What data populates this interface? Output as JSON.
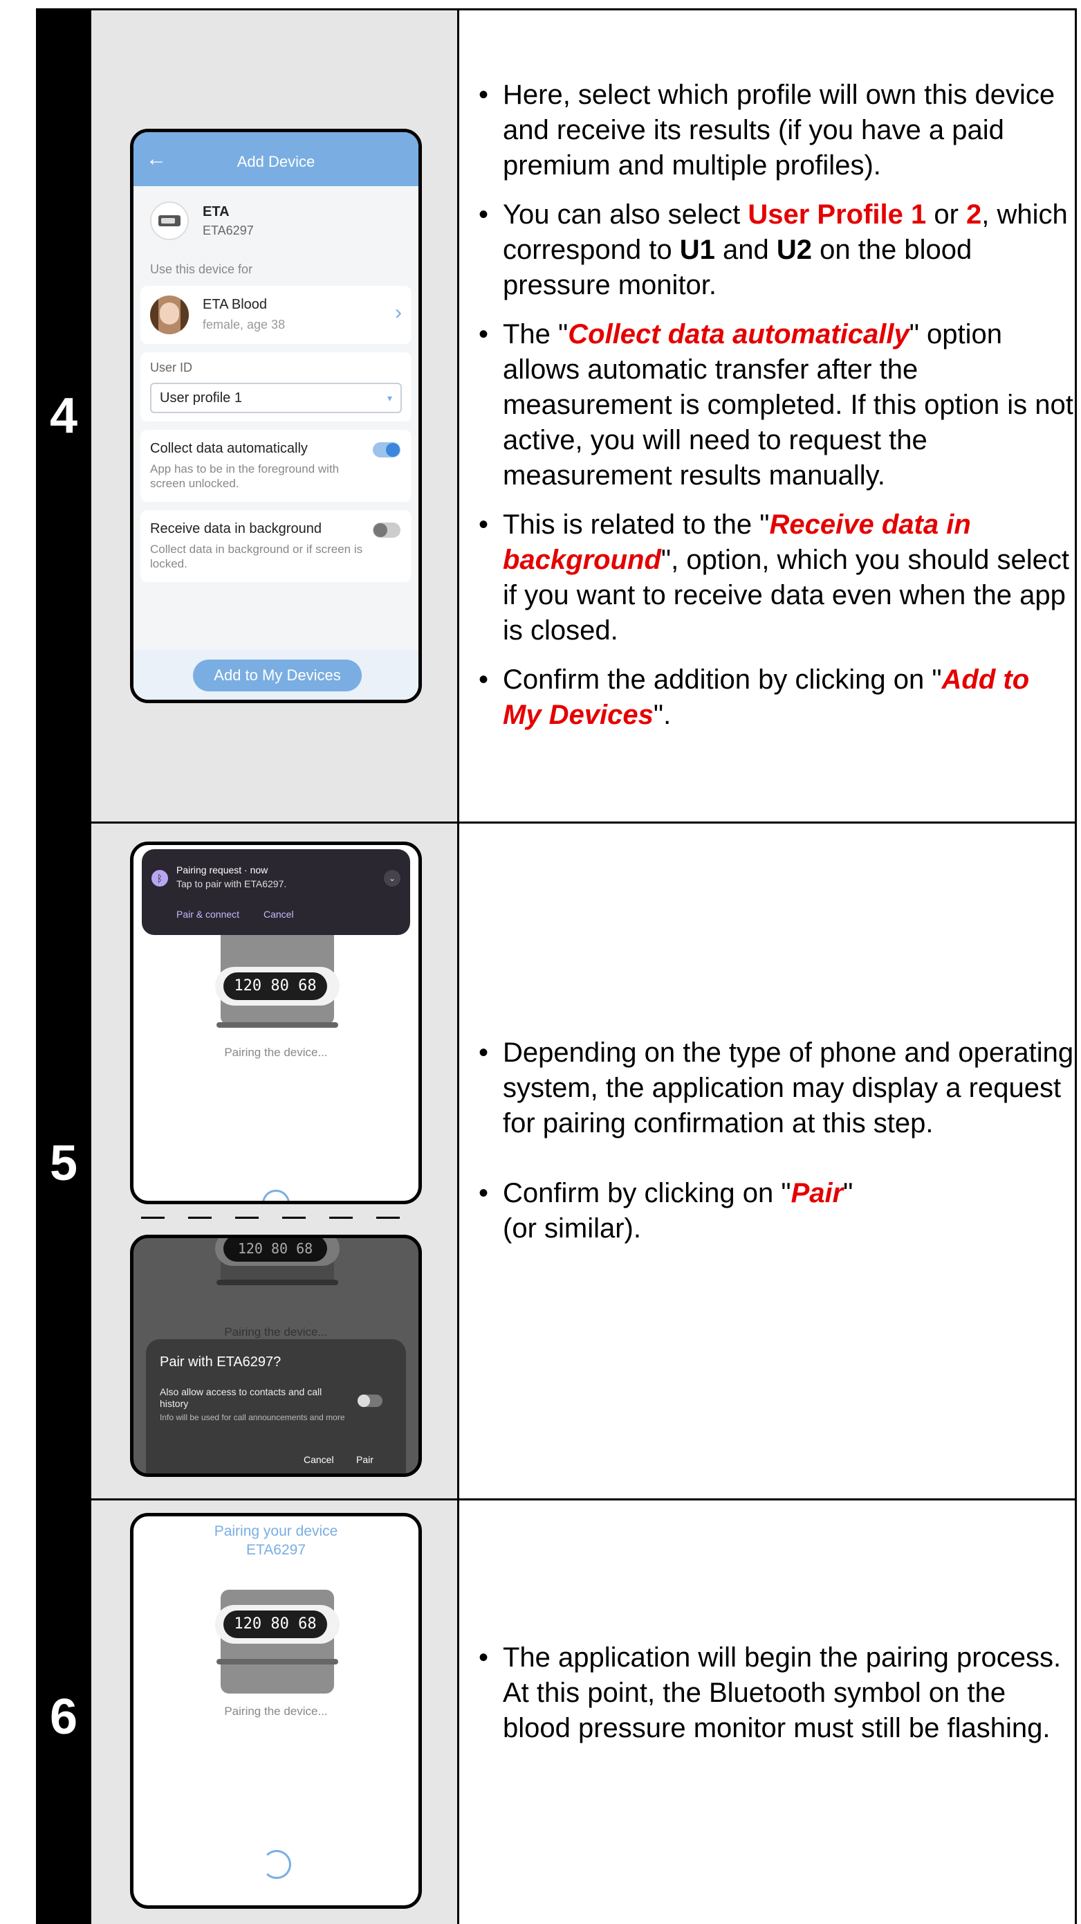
{
  "rows": [
    {
      "step": "4",
      "phone": {
        "title": "Add Device",
        "back_icon": "←",
        "device_name": "ETA",
        "device_model": "ETA6297",
        "use_for_label": "Use this device for",
        "profile_name": "ETA Blood",
        "profile_detail": "female, age 38",
        "user_id_label": "User ID",
        "user_id_value": "User profile 1",
        "collect_title": "Collect data automatically",
        "collect_desc": "App has to be in the foreground with screen unlocked.",
        "collect_on": true,
        "receive_title": "Receive data in background",
        "receive_desc": "Collect data in background or if screen is locked.",
        "receive_on": false,
        "add_button": "Add to My Devices"
      },
      "bullets": {
        "b1": "Here, select which profile will own this device and receive its results (if you have a paid premium and multiple profiles).",
        "b2_a": "You can also select ",
        "b2_red1": "User Profile 1",
        "b2_b": " or ",
        "b2_red2": "2",
        "b2_c": ", which correspond to ",
        "b2_u1": "U1",
        "b2_d": " and ",
        "b2_u2": "U2",
        "b2_e": " on the blood pressure monitor.",
        "b3_a": "The \"",
        "b3_red": "Collect data automatically",
        "b3_b": "\" option allows automatic transfer after the measurement is completed. If this option is not active, you will need to request the measurement results manually.",
        "b4_a": "This is related to the \"",
        "b4_red": "Receive data in background",
        "b4_b": "\", option, which you should select if you want to receive data even when the app is closed.",
        "b5_a": "Confirm the addition by clicking on \"",
        "b5_red": "Add to My Devices",
        "b5_b": "\"."
      }
    },
    {
      "step": "5",
      "phone_top": {
        "notif_title": "Pairing request · now",
        "notif_body": "Tap to pair with ETA6297.",
        "notif_action1": "Pair & connect",
        "notif_action2": "Cancel",
        "device_display": "120 80 68",
        "pairing_text": "Pairing the device..."
      },
      "phone_bottom": {
        "device_display": "120 80 68",
        "pairing_text": "Pairing the device...",
        "dialog_title": "Pair with ETA6297?",
        "dialog_option": "Also allow access to contacts and call history",
        "dialog_note": "Info will be used for call announcements and more",
        "dialog_cancel": "Cancel",
        "dialog_pair": "Pair"
      },
      "bullets": {
        "b1": "Depending on the type of phone and operating system, the application may display a request for pairing confirmation at this step.",
        "b2_a": "Confirm by clicking on \"",
        "b2_red": "Pair",
        "b2_b": "\"",
        "b2_c": "(or similar)."
      }
    },
    {
      "step": "6",
      "phone": {
        "title_line1": "Pairing your device",
        "title_line2": "ETA6297",
        "device_display": "120 80 68",
        "pairing_text": "Pairing the device..."
      },
      "bullets": {
        "b1": "The application will begin the pairing process. At this point, the Bluetooth symbol on the blood pressure monitor must still be flashing."
      }
    }
  ]
}
